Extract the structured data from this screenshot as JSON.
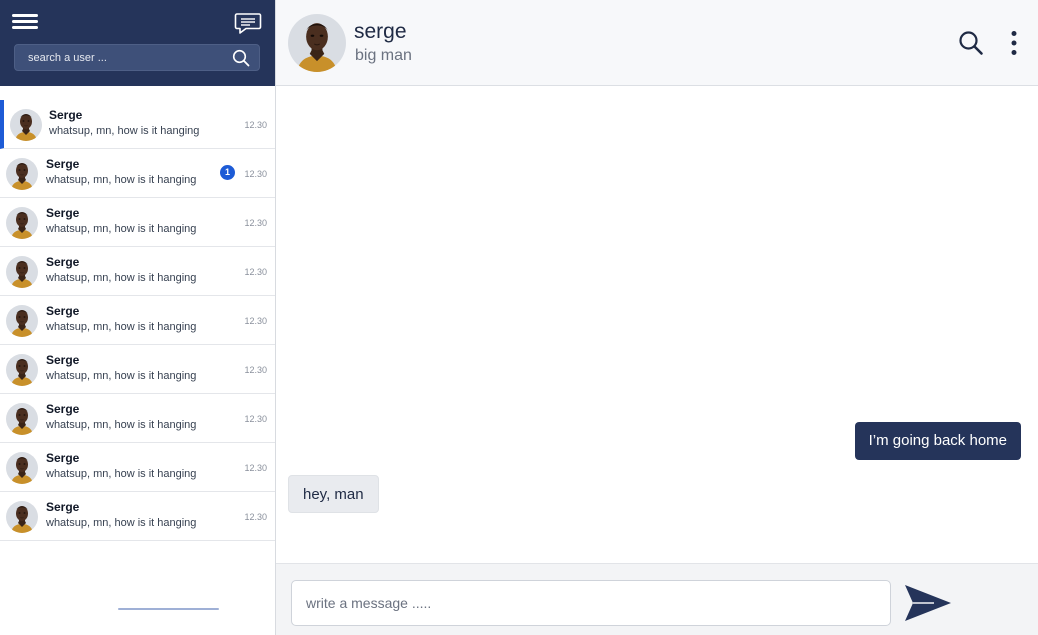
{
  "sidebar": {
    "search": {
      "placeholder": "search a user ..."
    },
    "conversations": [
      {
        "name": "Serge",
        "preview": "whatsup, mn, how is it hanging",
        "time": "12.30",
        "active": true,
        "unread": ""
      },
      {
        "name": "Serge",
        "preview": "whatsup, mn, how is it hanging",
        "time": "12.30",
        "active": false,
        "unread": "1"
      },
      {
        "name": "Serge",
        "preview": "whatsup, mn, how is it hanging",
        "time": "12.30",
        "active": false,
        "unread": ""
      },
      {
        "name": "Serge",
        "preview": "whatsup, mn, how is it hanging",
        "time": "12.30",
        "active": false,
        "unread": ""
      },
      {
        "name": "Serge",
        "preview": "whatsup, mn, how is it hanging",
        "time": "12.30",
        "active": false,
        "unread": ""
      },
      {
        "name": "Serge",
        "preview": "whatsup, mn, how is it hanging",
        "time": "12.30",
        "active": false,
        "unread": ""
      },
      {
        "name": "Serge",
        "preview": "whatsup, mn, how is it hanging",
        "time": "12.30",
        "active": false,
        "unread": ""
      },
      {
        "name": "Serge",
        "preview": "whatsup, mn, how is it hanging",
        "time": "12.30",
        "active": false,
        "unread": ""
      },
      {
        "name": "Serge",
        "preview": "whatsup, mn, how is it hanging",
        "time": "12.30",
        "active": false,
        "unread": ""
      }
    ]
  },
  "chat": {
    "contact_name": "serge",
    "contact_status": "big man",
    "messages": [
      {
        "direction": "out",
        "text": "I’m going back home"
      },
      {
        "direction": "in",
        "text": "hey, man"
      }
    ],
    "composer": {
      "placeholder": "write a message ....."
    }
  },
  "icons": {
    "menu": "hamburger-menu-icon",
    "new_chat": "chat-bubble-icon",
    "search": "search-icon",
    "more": "more-vertical-icon",
    "send": "send-icon"
  },
  "colors": {
    "brand_dark": "#25345a",
    "accent_blue": "#1d5bd6",
    "incoming_bubble": "#e9ebef"
  }
}
